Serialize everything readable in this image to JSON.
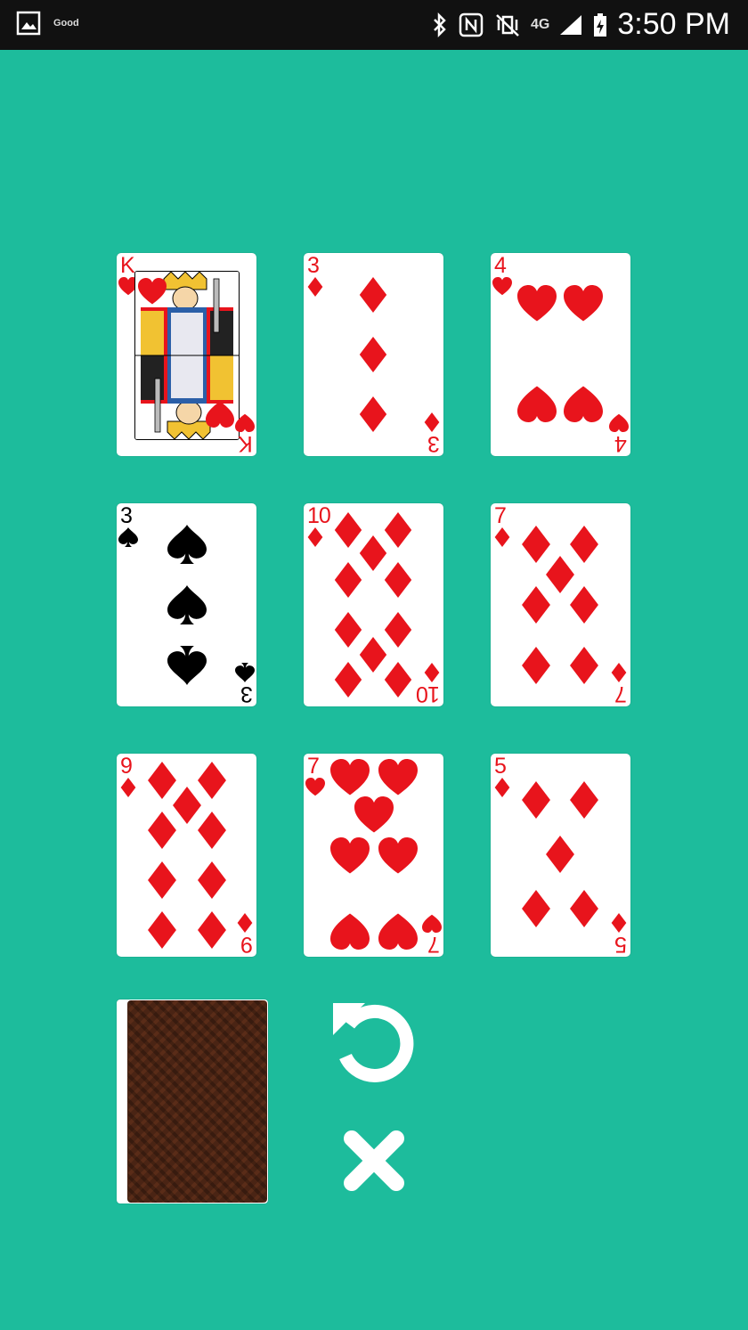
{
  "status_bar": {
    "time": "3:50 PM",
    "notification_label": "Good",
    "network": "4G"
  },
  "colors": {
    "background": "#1dbc9c",
    "red_suit": "#e8141c",
    "black_suit": "#000000",
    "card_back": "#4a2414"
  },
  "cards": [
    {
      "rank": "K",
      "suit": "hearts",
      "color": "red",
      "face": true
    },
    {
      "rank": "3",
      "suit": "diamonds",
      "color": "red"
    },
    {
      "rank": "4",
      "suit": "hearts",
      "color": "red"
    },
    {
      "rank": "3",
      "suit": "spades",
      "color": "black"
    },
    {
      "rank": "10",
      "suit": "diamonds",
      "color": "red"
    },
    {
      "rank": "7",
      "suit": "diamonds",
      "color": "red"
    },
    {
      "rank": "9",
      "suit": "diamonds",
      "color": "red"
    },
    {
      "rank": "7",
      "suit": "hearts",
      "color": "red"
    },
    {
      "rank": "5",
      "suit": "diamonds",
      "color": "red"
    }
  ],
  "controls": {
    "deck_icon": "card-back-deck",
    "restart_icon": "restart-icon",
    "close_icon": "close-icon"
  }
}
